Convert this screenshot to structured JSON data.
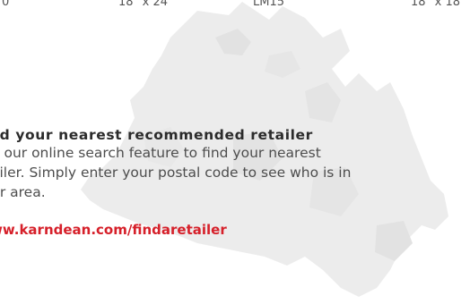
{
  "specs": [
    "18\" x 24\"",
    "LM15",
    "18\" x 18\""
  ],
  "spec_partial": "0",
  "retailer": {
    "heading": "nd your nearest recommended retailer",
    "lines": [
      "e our online search feature to find your nearest",
      "ailer. Simply enter your postal code to see who is in",
      "ur area."
    ],
    "link": "ww.karndean.com/findaretailer"
  },
  "colors": {
    "link": "#d6202a",
    "map": "#ececec"
  }
}
